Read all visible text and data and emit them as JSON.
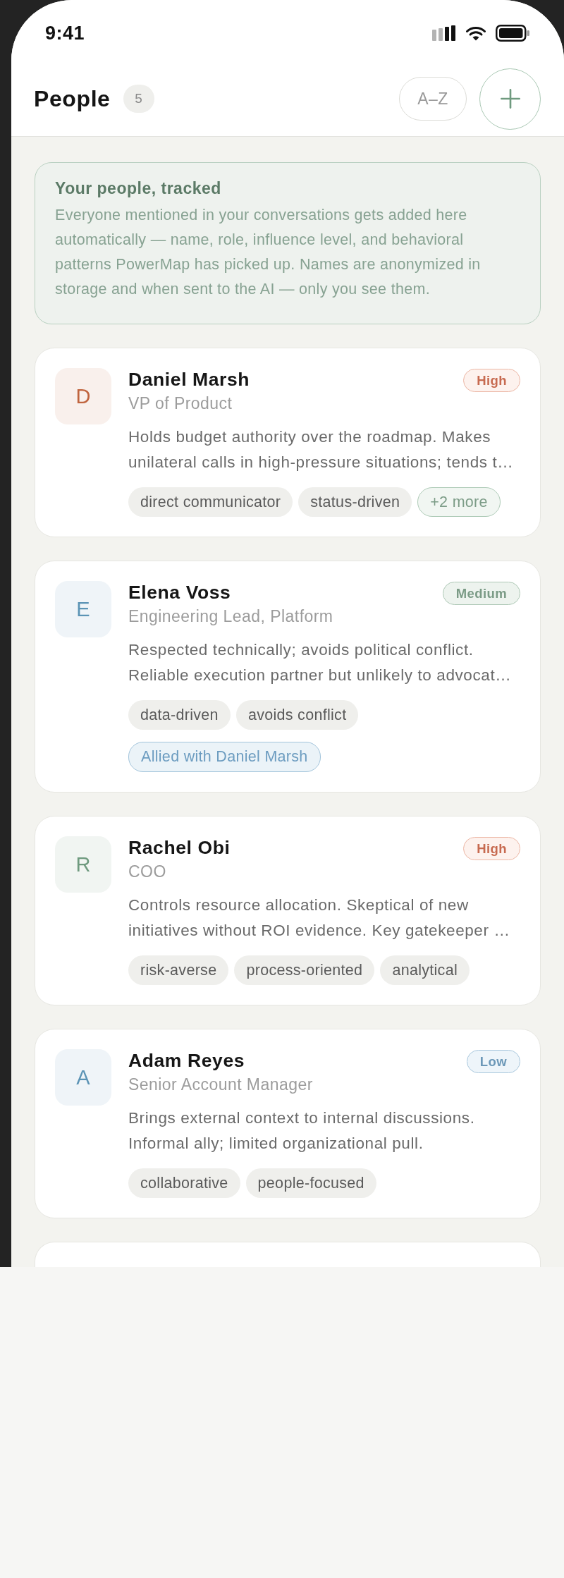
{
  "status_bar": {
    "time": "9:41"
  },
  "header": {
    "title": "People",
    "count": "5",
    "sort_button": "A–Z"
  },
  "info_card": {
    "title": "Your people, tracked",
    "body": "Everyone mentioned in your conversations gets added here automatically — name, role, influence level, and behavioral patterns PowerMap has picked up. Names are anonymized in storage and when sent to the AI — only you see them."
  },
  "people": [
    {
      "avatar": {
        "letter": "D",
        "color": "#c0643e"
      },
      "name": "Daniel Marsh",
      "role": "VP of Product",
      "influence": {
        "text": "High",
        "kind": "high"
      },
      "summary": "Holds budget authority over the roadmap. Makes unilateral calls in high-pressure situations; tends t…",
      "tags": [
        {
          "text": "direct communicator",
          "kind": "trait"
        },
        {
          "text": "status-driven",
          "kind": "trait"
        },
        {
          "text": "+2 more",
          "kind": "more"
        }
      ]
    },
    {
      "avatar": {
        "letter": "E",
        "color": "#5b93b5"
      },
      "name": "Elena Voss",
      "role": "Engineering Lead, Platform",
      "influence": {
        "text": "Medium",
        "kind": "medium"
      },
      "summary": "Respected technically; avoids political conflict. Reliable execution partner but unlikely to advocat…",
      "tags": [
        {
          "text": "data-driven",
          "kind": "trait"
        },
        {
          "text": "avoids conflict",
          "kind": "trait"
        }
      ],
      "relations": [
        {
          "text": "Allied with Daniel Marsh"
        }
      ]
    },
    {
      "avatar": {
        "letter": "R",
        "color": "#6f9a7f"
      },
      "name": "Rachel Obi",
      "role": "COO",
      "influence": {
        "text": "High",
        "kind": "high"
      },
      "summary": "Controls resource allocation. Skeptical of new initiatives without ROI evidence. Key gatekeeper …",
      "tags": [
        {
          "text": "risk-averse",
          "kind": "trait"
        },
        {
          "text": "process-oriented",
          "kind": "trait"
        },
        {
          "text": "analytical",
          "kind": "trait"
        }
      ]
    },
    {
      "avatar": {
        "letter": "A",
        "color": "#5b93b5"
      },
      "name": "Adam Reyes",
      "role": "Senior Account Manager",
      "influence": {
        "text": "Low",
        "kind": "low"
      },
      "summary": "Brings external context to internal discussions. Informal ally; limited organizational pull.",
      "tags": [
        {
          "text": "collaborative",
          "kind": "trait"
        },
        {
          "text": "people-focused",
          "kind": "trait"
        }
      ]
    }
  ]
}
